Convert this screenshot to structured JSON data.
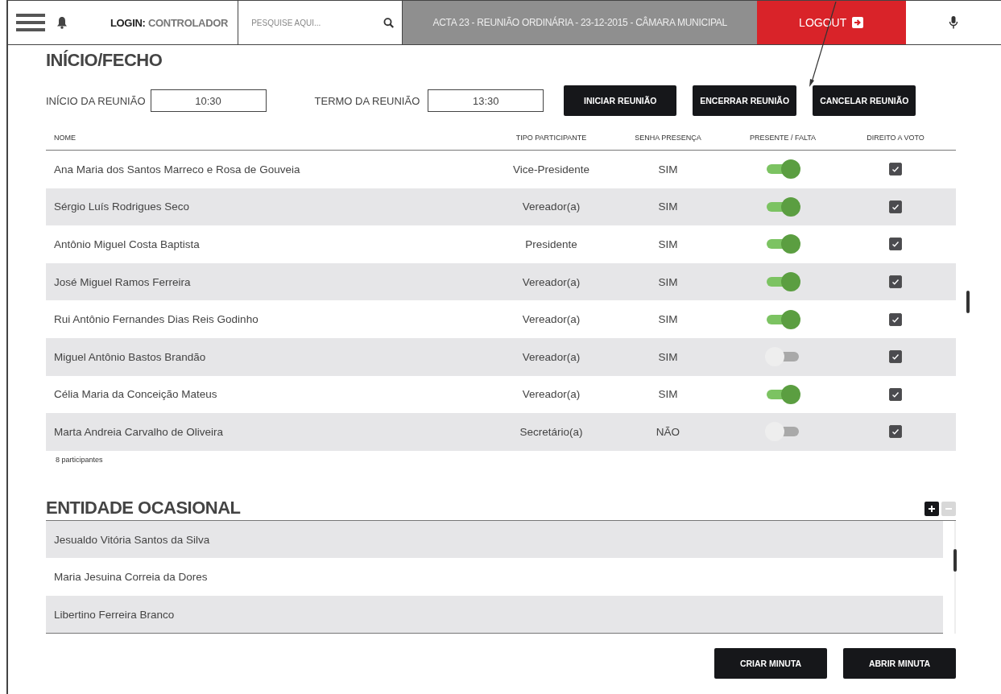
{
  "top_bar": {
    "login_label": "LOGIN:",
    "login_user": "CONTROLADOR",
    "search": {
      "placeholder": "PESQUISE AQUI..."
    },
    "title": "ACTA 23 - REUNIÃO ORDINÁRIA - 23-12-2015 - CÂMARA MUNICIPAL",
    "logout": "LOGOUT"
  },
  "section": {
    "title": "INÍCIO/FECHO",
    "start": {
      "label": "INÍCIO DA REUNIÃO",
      "value": "10:30"
    },
    "end": {
      "label": "TERMO DA REUNIÃO",
      "value": "13:30"
    },
    "buttons": [
      "INICIAR REUNIÃO",
      "ENCERRAR REUNIÃO",
      "CANCELAR REUNIÃO"
    ]
  },
  "table": {
    "columns": [
      "NOME",
      "TIPO PARTICIPANTE",
      "SENHA PRESENÇA",
      "PRESENTE / FALTA",
      "DIREITO A VOTO"
    ],
    "rows": [
      {
        "name": "Ana Maria dos Santos Marreco e Rosa de Gouveia",
        "type": "Vice-Presidente",
        "password": "SIM",
        "present": true,
        "vote": true
      },
      {
        "name": "Sérgio Luís Rodrigues Seco",
        "type": "Vereador(a)",
        "password": "SIM",
        "present": true,
        "vote": true
      },
      {
        "name": "Antônio Miguel Costa Baptista",
        "type": "Presidente",
        "password": "SIM",
        "present": true,
        "vote": true
      },
      {
        "name": "José Miguel Ramos Ferreira",
        "type": "Vereador(a)",
        "password": "SIM",
        "present": true,
        "vote": true
      },
      {
        "name": "Rui Antônio Fernandes Dias Reis Godinho",
        "type": "Vereador(a)",
        "password": "SIM",
        "present": true,
        "vote": true
      },
      {
        "name": "Miguel Antônio Bastos Brandão",
        "type": "Vereador(a)",
        "password": "SIM",
        "present": false,
        "vote": true
      },
      {
        "name": "Célia Maria da Conceição Mateus",
        "type": "Vereador(a)",
        "password": "SIM",
        "present": true,
        "vote": true
      },
      {
        "name": "Marta Andreia Carvalho de Oliveira",
        "type": "Secretário(a)",
        "password": "NÃO",
        "present": false,
        "vote": true
      }
    ],
    "count": "8 participantes"
  },
  "occasional": {
    "title": "ENTIDADE OCASIONAL",
    "add_disabled": false,
    "remove_disabled": true,
    "items": [
      "Jesualdo Vitória Santos da Silva",
      "Maria Jesuina Correia da Dores",
      "Libertino Ferreira Branco"
    ]
  },
  "footer_buttons": [
    "CRIAR MINUTA",
    "ABRIR MINUTA"
  ]
}
